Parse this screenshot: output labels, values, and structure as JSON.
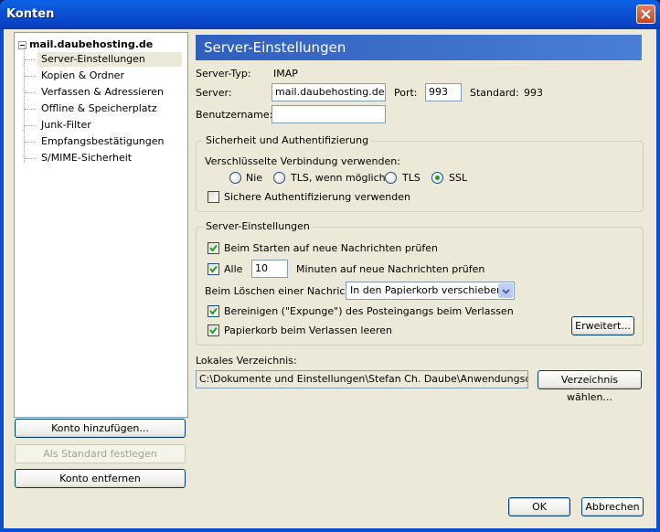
{
  "window": {
    "title": "Konten"
  },
  "tree": {
    "account": "mail.daubehosting.de",
    "items": [
      "Server-Einstellungen",
      "Kopien & Ordner",
      "Verfassen & Adressieren",
      "Offline & Speicherplatz",
      "Junk-Filter",
      "Empfangsbestätigungen",
      "S/MIME-Sicherheit"
    ]
  },
  "left_buttons": {
    "add_account": "Konto hinzufügen...",
    "set_default": "Als Standard festlegen",
    "remove_account": "Konto entfernen"
  },
  "panel": {
    "header": "Server-Einstellungen",
    "server_type_label": "Server-Typ:",
    "server_type_value": "IMAP",
    "server_label": "Server:",
    "server_value": "mail.daubehosting.de",
    "port_label": "Port:",
    "port_value": "993",
    "standard_label": "Standard:",
    "standard_value": "993",
    "username_label": "Benutzername:",
    "username_value": ""
  },
  "security": {
    "group_title": "Sicherheit und Authentifizierung",
    "encryption_label": "Verschlüsselte Verbindung verwenden:",
    "options": [
      "Nie",
      "TLS, wenn möglich",
      "TLS",
      "SSL"
    ],
    "selected": "SSL",
    "secure_auth_label": "Sichere Authentifizierung verwenden",
    "secure_auth_checked": false
  },
  "server_settings": {
    "group_title": "Server-Einstellungen",
    "check_on_start": "Beim Starten auf neue Nachrichten prüfen",
    "every_label": "Alle",
    "every_value": "10",
    "minutes_label": "Minuten auf neue Nachrichten prüfen",
    "on_delete_label": "Beim Löschen einer Nachricht:",
    "on_delete_value": "In den Papierkorb verschieben",
    "expunge_label": "Bereinigen (\"Expunge\") des Posteingangs beim Verlassen",
    "empty_trash_label": "Papierkorb beim Verlassen leeren",
    "advanced_button": "Erweitert..."
  },
  "local_dir": {
    "label": "Lokales Verzeichnis:",
    "path": "C:\\Dokumente und Einstellungen\\Stefan Ch. Daube\\Anwendungsdaten\\Thunderbird",
    "choose_button": "Verzeichnis wählen..."
  },
  "footer": {
    "ok": "OK",
    "cancel": "Abbrechen"
  }
}
